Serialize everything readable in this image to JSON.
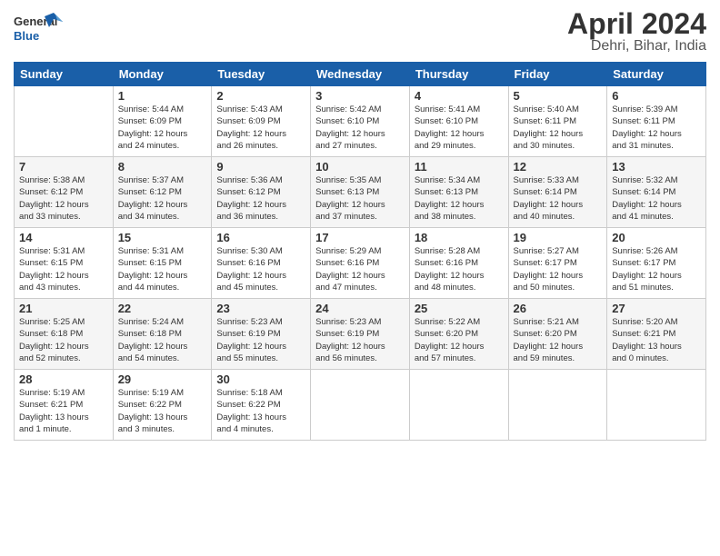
{
  "logo": {
    "line1": "General",
    "line2": "Blue"
  },
  "title": "April 2024",
  "location": "Dehri, Bihar, India",
  "headers": [
    "Sunday",
    "Monday",
    "Tuesday",
    "Wednesday",
    "Thursday",
    "Friday",
    "Saturday"
  ],
  "weeks": [
    [
      {
        "day": "",
        "info": ""
      },
      {
        "day": "1",
        "info": "Sunrise: 5:44 AM\nSunset: 6:09 PM\nDaylight: 12 hours\nand 24 minutes."
      },
      {
        "day": "2",
        "info": "Sunrise: 5:43 AM\nSunset: 6:09 PM\nDaylight: 12 hours\nand 26 minutes."
      },
      {
        "day": "3",
        "info": "Sunrise: 5:42 AM\nSunset: 6:10 PM\nDaylight: 12 hours\nand 27 minutes."
      },
      {
        "day": "4",
        "info": "Sunrise: 5:41 AM\nSunset: 6:10 PM\nDaylight: 12 hours\nand 29 minutes."
      },
      {
        "day": "5",
        "info": "Sunrise: 5:40 AM\nSunset: 6:11 PM\nDaylight: 12 hours\nand 30 minutes."
      },
      {
        "day": "6",
        "info": "Sunrise: 5:39 AM\nSunset: 6:11 PM\nDaylight: 12 hours\nand 31 minutes."
      }
    ],
    [
      {
        "day": "7",
        "info": "Sunrise: 5:38 AM\nSunset: 6:12 PM\nDaylight: 12 hours\nand 33 minutes."
      },
      {
        "day": "8",
        "info": "Sunrise: 5:37 AM\nSunset: 6:12 PM\nDaylight: 12 hours\nand 34 minutes."
      },
      {
        "day": "9",
        "info": "Sunrise: 5:36 AM\nSunset: 6:12 PM\nDaylight: 12 hours\nand 36 minutes."
      },
      {
        "day": "10",
        "info": "Sunrise: 5:35 AM\nSunset: 6:13 PM\nDaylight: 12 hours\nand 37 minutes."
      },
      {
        "day": "11",
        "info": "Sunrise: 5:34 AM\nSunset: 6:13 PM\nDaylight: 12 hours\nand 38 minutes."
      },
      {
        "day": "12",
        "info": "Sunrise: 5:33 AM\nSunset: 6:14 PM\nDaylight: 12 hours\nand 40 minutes."
      },
      {
        "day": "13",
        "info": "Sunrise: 5:32 AM\nSunset: 6:14 PM\nDaylight: 12 hours\nand 41 minutes."
      }
    ],
    [
      {
        "day": "14",
        "info": "Sunrise: 5:31 AM\nSunset: 6:15 PM\nDaylight: 12 hours\nand 43 minutes."
      },
      {
        "day": "15",
        "info": "Sunrise: 5:31 AM\nSunset: 6:15 PM\nDaylight: 12 hours\nand 44 minutes."
      },
      {
        "day": "16",
        "info": "Sunrise: 5:30 AM\nSunset: 6:16 PM\nDaylight: 12 hours\nand 45 minutes."
      },
      {
        "day": "17",
        "info": "Sunrise: 5:29 AM\nSunset: 6:16 PM\nDaylight: 12 hours\nand 47 minutes."
      },
      {
        "day": "18",
        "info": "Sunrise: 5:28 AM\nSunset: 6:16 PM\nDaylight: 12 hours\nand 48 minutes."
      },
      {
        "day": "19",
        "info": "Sunrise: 5:27 AM\nSunset: 6:17 PM\nDaylight: 12 hours\nand 50 minutes."
      },
      {
        "day": "20",
        "info": "Sunrise: 5:26 AM\nSunset: 6:17 PM\nDaylight: 12 hours\nand 51 minutes."
      }
    ],
    [
      {
        "day": "21",
        "info": "Sunrise: 5:25 AM\nSunset: 6:18 PM\nDaylight: 12 hours\nand 52 minutes."
      },
      {
        "day": "22",
        "info": "Sunrise: 5:24 AM\nSunset: 6:18 PM\nDaylight: 12 hours\nand 54 minutes."
      },
      {
        "day": "23",
        "info": "Sunrise: 5:23 AM\nSunset: 6:19 PM\nDaylight: 12 hours\nand 55 minutes."
      },
      {
        "day": "24",
        "info": "Sunrise: 5:23 AM\nSunset: 6:19 PM\nDaylight: 12 hours\nand 56 minutes."
      },
      {
        "day": "25",
        "info": "Sunrise: 5:22 AM\nSunset: 6:20 PM\nDaylight: 12 hours\nand 57 minutes."
      },
      {
        "day": "26",
        "info": "Sunrise: 5:21 AM\nSunset: 6:20 PM\nDaylight: 12 hours\nand 59 minutes."
      },
      {
        "day": "27",
        "info": "Sunrise: 5:20 AM\nSunset: 6:21 PM\nDaylight: 13 hours\nand 0 minutes."
      }
    ],
    [
      {
        "day": "28",
        "info": "Sunrise: 5:19 AM\nSunset: 6:21 PM\nDaylight: 13 hours\nand 1 minute."
      },
      {
        "day": "29",
        "info": "Sunrise: 5:19 AM\nSunset: 6:22 PM\nDaylight: 13 hours\nand 3 minutes."
      },
      {
        "day": "30",
        "info": "Sunrise: 5:18 AM\nSunset: 6:22 PM\nDaylight: 13 hours\nand 4 minutes."
      },
      {
        "day": "",
        "info": ""
      },
      {
        "day": "",
        "info": ""
      },
      {
        "day": "",
        "info": ""
      },
      {
        "day": "",
        "info": ""
      }
    ]
  ]
}
